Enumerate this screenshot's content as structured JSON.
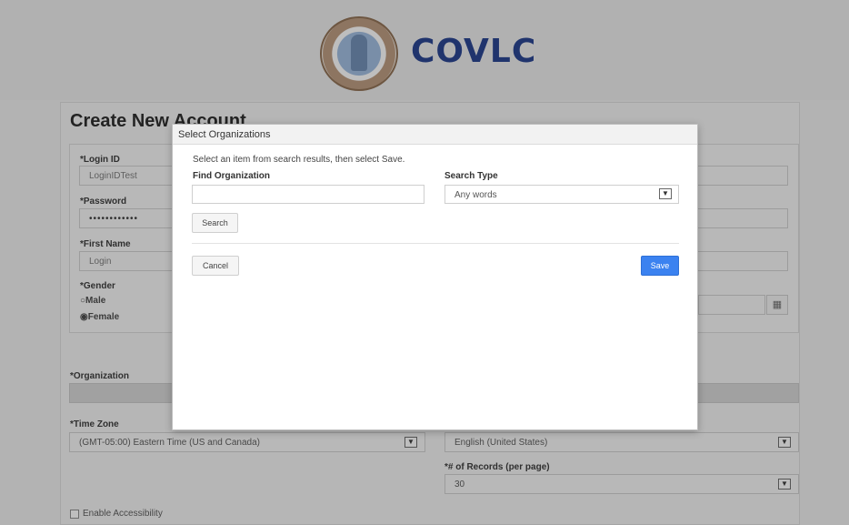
{
  "brand": {
    "name": "COVLC"
  },
  "page": {
    "title": "Create New Account"
  },
  "form": {
    "login_id_label": "*Login ID",
    "login_id_value": "LoginIDTest",
    "password_label": "*Password",
    "password_value": "••••••••••••",
    "first_name_label": "*First Name",
    "first_name_value": "Login",
    "gender_label": "*Gender",
    "gender_options": [
      "Male",
      "Female"
    ],
    "gender_selected": "Female",
    "organization_label": "*Organization",
    "time_zone_label": "*Time Zone",
    "time_zone_value": "(GMT-05:00) Eastern Time (US and Canada)",
    "language_value": "English (United States)",
    "records_label": "*# of Records (per page)",
    "records_value": "30",
    "enable_accessibility_label": "Enable Accessibility"
  },
  "modal": {
    "title": "Select Organizations",
    "instruction": "Select an item from search results, then select Save.",
    "find_label": "Find Organization",
    "find_value": "",
    "search_type_label": "Search Type",
    "search_type_value": "Any words",
    "search_button": "Search",
    "cancel_button": "Cancel",
    "save_button": "Save"
  },
  "colors": {
    "brand_blue": "#1d3a8c",
    "primary_button": "#3b82f0"
  },
  "icons": {
    "dropdown": "chevron-down-icon",
    "calendar": "calendar-icon",
    "seal": "state-seal-logo"
  }
}
